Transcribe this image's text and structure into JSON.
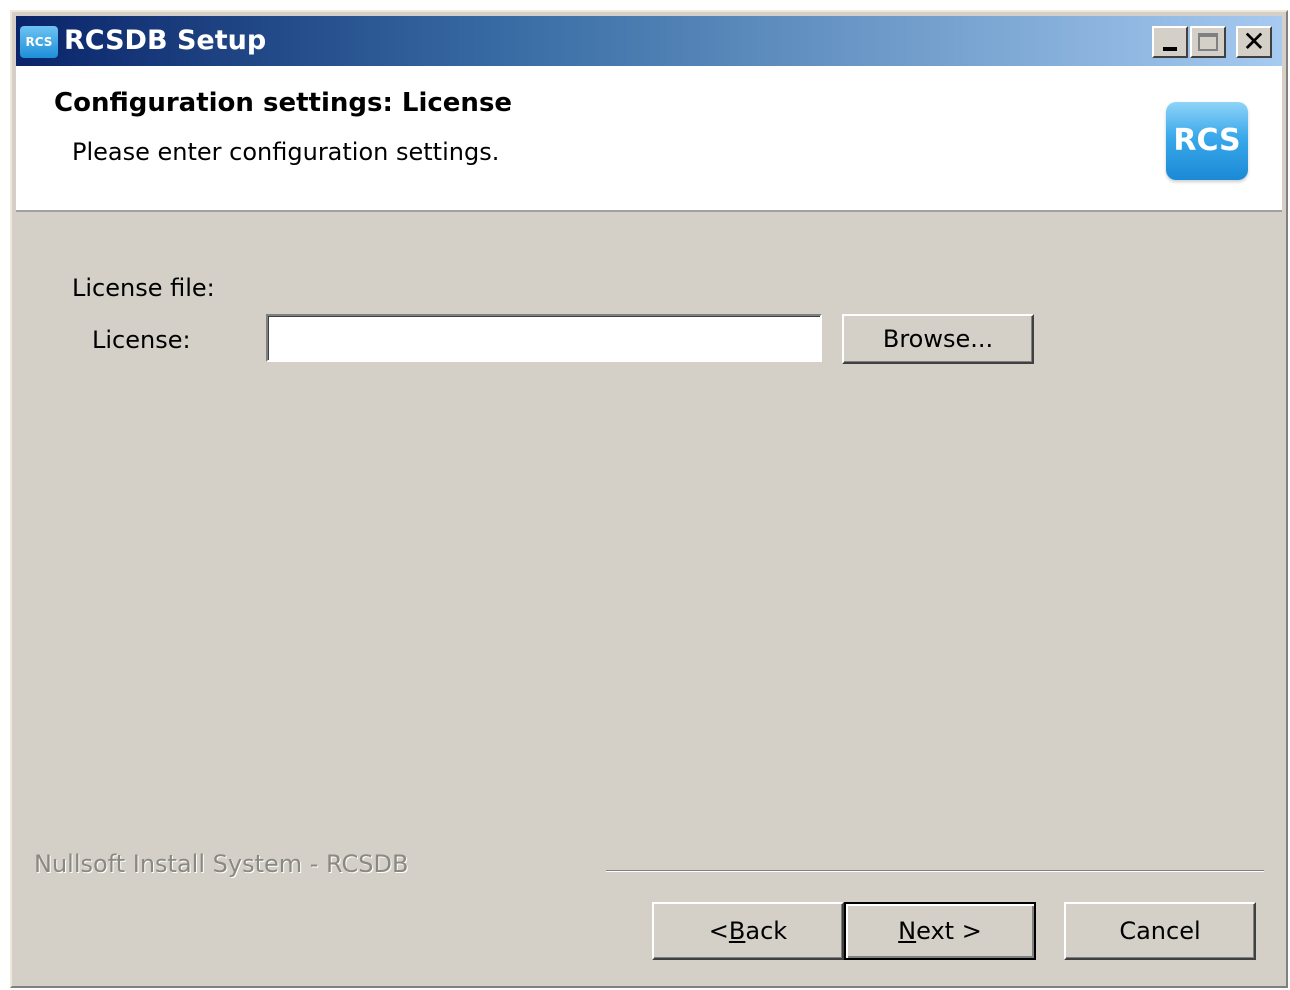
{
  "window": {
    "title": "RCSDB Setup",
    "icon_label": "RCS"
  },
  "titlebar_buttons": {
    "minimize": "minimize-icon",
    "maximize": "maximize-icon",
    "close": "close-icon",
    "close_glyph": "✕"
  },
  "header": {
    "title": "Configuration settings: License",
    "subtitle": "Please enter configuration settings.",
    "logo_text": "RCS"
  },
  "form": {
    "section_label": "License file:",
    "license_label": "License:",
    "license_value": "",
    "browse_label": "Browse..."
  },
  "footer": {
    "branding": "Nullsoft Install System - RCSDB",
    "back_prefix": "< ",
    "back_mnemonic": "B",
    "back_rest": "ack",
    "next_mnemonic": "N",
    "next_rest": "ext >",
    "cancel_label": "Cancel"
  },
  "colors": {
    "title_gradient_start": "#0a246a",
    "title_gradient_end": "#a6caf0",
    "dialog_bg": "#d4d0c8",
    "header_bg": "#ffffff",
    "logo_blue": "#3aa8ea"
  }
}
